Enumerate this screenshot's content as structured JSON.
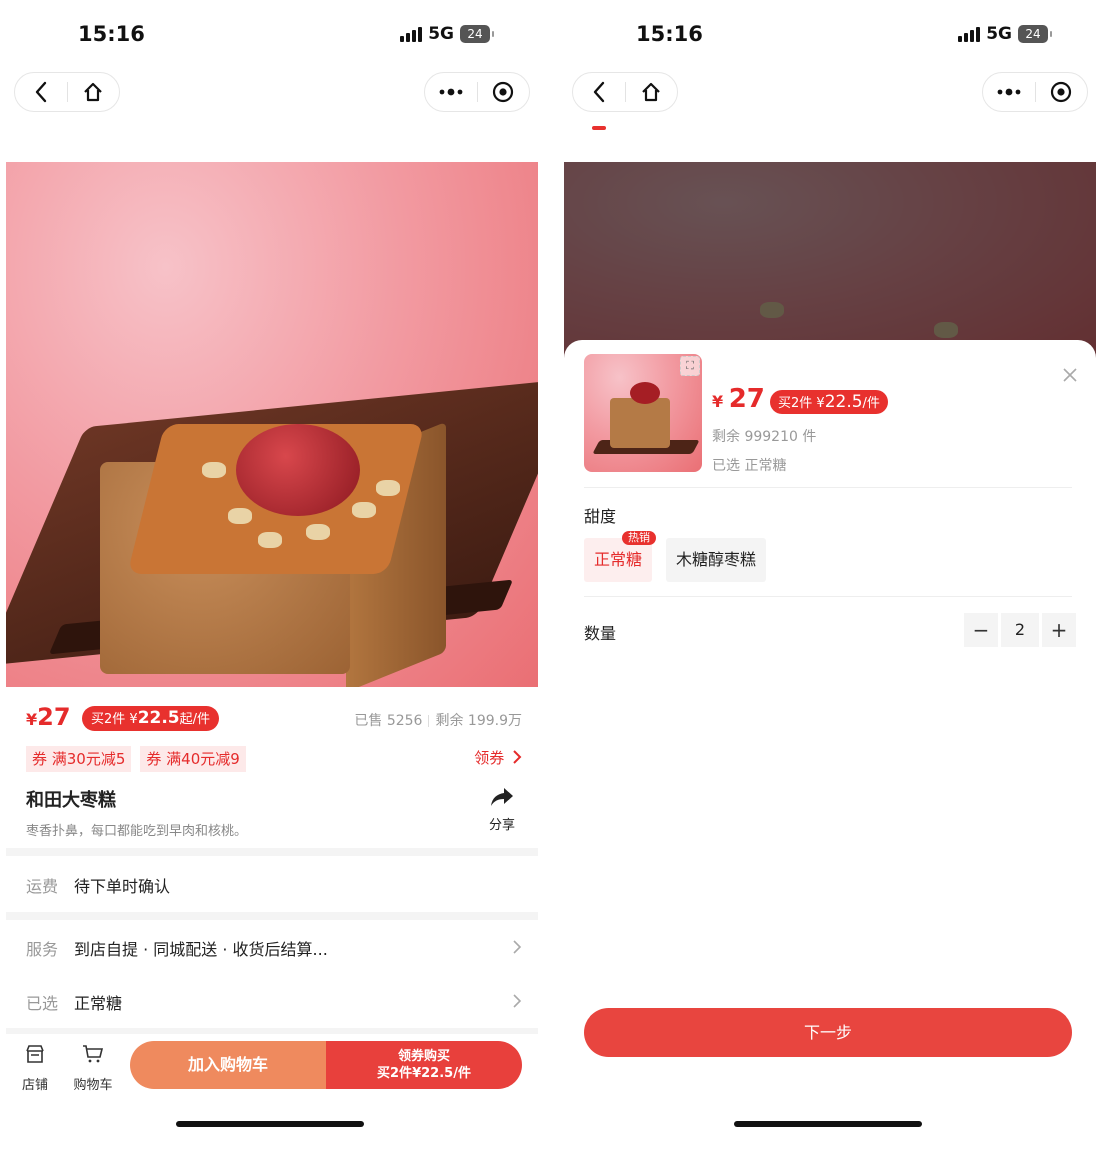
{
  "status_bar": {
    "time": "15:16",
    "network": "5G",
    "battery": "24"
  },
  "nav": {
    "back_icon": "chevron-left-icon",
    "home_icon": "home-icon",
    "more_icon": "more-dots-icon",
    "record_icon": "record-circle-icon"
  },
  "detail": {
    "price_symbol": "¥",
    "price": "27",
    "promo_prefix": "买2件 ¥",
    "promo_price": "22.5",
    "promo_suffix": "起/件",
    "sold": "已售 5256",
    "remaining": "剩余 199.9万",
    "coupons": [
      "券 满30元减5",
      "券 满40元减9"
    ],
    "get_coupon": "领券",
    "title": "和田大枣糕",
    "description": "枣香扑鼻，每口都能吃到早肉和核桃。",
    "share_label": "分享",
    "shipping": {
      "key": "运费",
      "value": "待下单时确认"
    },
    "service": {
      "key": "服务",
      "value": "到店自提 · 同城配送 · 收货后结算..."
    },
    "selected": {
      "key": "已选",
      "value": "正常糖"
    }
  },
  "bottom_bar": {
    "store_label": "店铺",
    "cart_label": "购物车",
    "add_cart": "加入购物车",
    "buy_line1": "领券购买",
    "buy_line2": "买2件¥22.5/件"
  },
  "sheet": {
    "price_symbol": "¥",
    "price": "27",
    "promo_prefix": "买2件 ¥",
    "promo_price": "22.5",
    "promo_suffix": "/件",
    "stock": "剩余 999210 件",
    "selected": "已选 正常糖",
    "close_icon": "close-icon",
    "sweetness_title": "甜度",
    "options": [
      {
        "label": "正常糖",
        "selected": true,
        "badge": "热销"
      },
      {
        "label": "木糖醇枣糕",
        "selected": false
      }
    ],
    "quantity_title": "数量",
    "quantity": "2",
    "minus": "−",
    "plus": "+",
    "next_button": "下一步"
  },
  "colors": {
    "accent": "#e8312e",
    "cart_orange": "#ef8a5e",
    "price_red": "#e52b2b"
  }
}
